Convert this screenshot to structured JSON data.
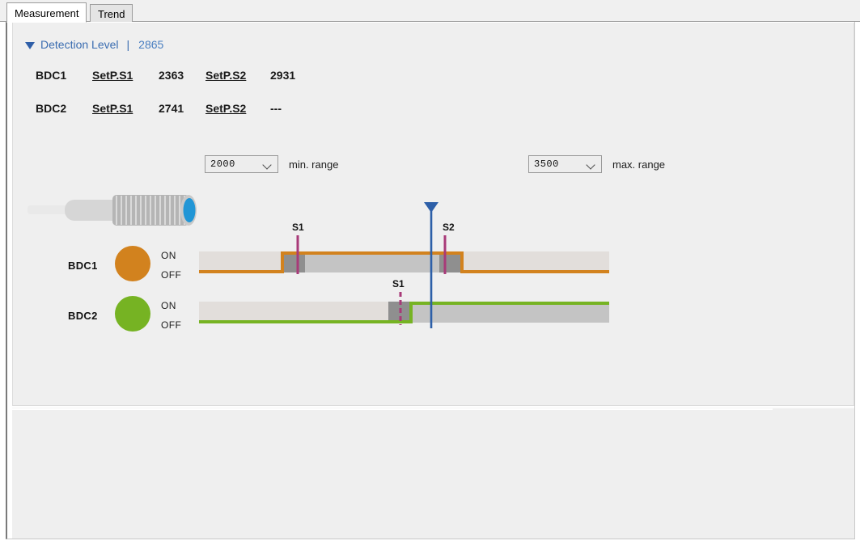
{
  "window": {
    "title": "Measurement"
  },
  "tabs": [
    {
      "id": "measurement",
      "label": "Measurement",
      "active": true
    },
    {
      "id": "trend",
      "label": "Trend",
      "active": false
    }
  ],
  "detection": {
    "triangle_icon": "collapse-triangle-icon",
    "label": "Detection Level",
    "separator": "|",
    "value": "2865",
    "color": "#3a6cb0"
  },
  "setpoints": [
    {
      "channel": "BDC1",
      "s1_label": "SetP.S1",
      "s1_value": "2363",
      "s2_label": "SetP.S2",
      "s2_value": "2931"
    },
    {
      "channel": "BDC2",
      "s1_label": "SetP.S1",
      "s1_value": "2741",
      "s2_label": "SetP.S2",
      "s2_value": "---"
    }
  ],
  "ranges": [
    {
      "id": "min",
      "value": "2000",
      "caption": "min. range"
    },
    {
      "id": "max",
      "value": "3500",
      "caption": "max. range"
    }
  ],
  "sensor": {
    "icon": "proximity-sensor-icon",
    "cable_color": "#e8e8e8",
    "body_color": "#d4d4d4",
    "thread_color": "#b9b9b9",
    "face_color": "#2196d6"
  },
  "channels": [
    {
      "name": "BDC1",
      "led_color": "#d2821e",
      "trace_color": "#d2821e",
      "state_on": "ON",
      "state_off": "OFF",
      "initial_state": "OFF",
      "transitions": [
        {
          "marker": "S1",
          "edge": "rising"
        },
        {
          "marker": "S2",
          "edge": "falling"
        }
      ]
    },
    {
      "name": "BDC2",
      "led_color": "#76b323",
      "trace_color": "#76b323",
      "state_on": "ON",
      "state_off": "OFF",
      "initial_state": "OFF",
      "transitions": [
        {
          "marker": "S1",
          "edge": "rising"
        }
      ]
    }
  ],
  "markers": [
    {
      "label": "S1",
      "channel": "BDC1",
      "style": "solid",
      "color": "#a83a78"
    },
    {
      "label": "S2",
      "channel": "BDC1",
      "style": "solid",
      "color": "#a83a78"
    },
    {
      "label": "S1",
      "channel": "BDC2",
      "style": "dashed",
      "color": "#a83a78"
    }
  ],
  "cursor": {
    "icon": "cursor-triangle-icon",
    "color": "#2d5fa8"
  },
  "colors": {
    "panel_bg": "#efefef",
    "track_low": "#e2dedb",
    "track_high": "#c4c4c4",
    "band_gray": "#8f8f8f"
  }
}
